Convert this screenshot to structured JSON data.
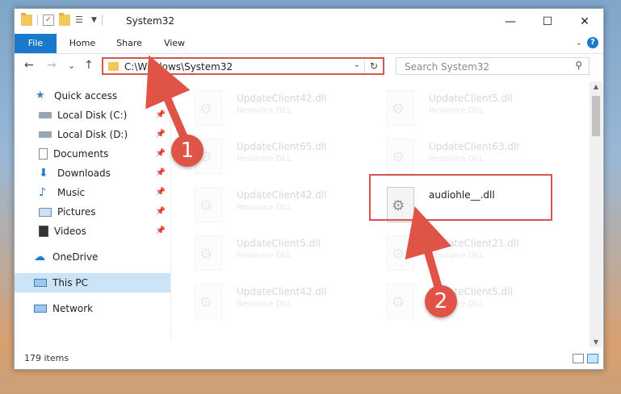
{
  "window": {
    "title": "System32",
    "controls": {
      "minimize": "—",
      "maximize": "☐",
      "close": "✕"
    }
  },
  "ribbon": {
    "tabs": [
      "File",
      "Home",
      "Share",
      "View"
    ],
    "help": "?"
  },
  "navigation": {
    "back": "←",
    "forward": "→",
    "recent": "⌄",
    "up": "↑",
    "address": "C:\\Windows\\System32",
    "search_placeholder": "Search System32"
  },
  "sidebar": {
    "items": [
      {
        "label": "Quick access",
        "icon": "star-icon",
        "pinned": false
      },
      {
        "label": "Local Disk (C:)",
        "icon": "drive-icon",
        "pinned": true
      },
      {
        "label": "Local Disk (D:)",
        "icon": "drive-icon",
        "pinned": true
      },
      {
        "label": "Documents",
        "icon": "documents-icon",
        "pinned": true
      },
      {
        "label": "Downloads",
        "icon": "downloads-icon",
        "pinned": true
      },
      {
        "label": "Music",
        "icon": "music-icon",
        "pinned": true
      },
      {
        "label": "Pictures",
        "icon": "pictures-icon",
        "pinned": true
      },
      {
        "label": "Videos",
        "icon": "videos-icon",
        "pinned": true
      },
      {
        "label": "OneDrive",
        "icon": "cloud-icon",
        "pinned": false
      },
      {
        "label": "This PC",
        "icon": "computer-icon",
        "pinned": false,
        "selected": true
      },
      {
        "label": "Network",
        "icon": "network-icon",
        "pinned": false
      }
    ]
  },
  "files": [
    {
      "name": "UpdateClient42.dll",
      "type": "Resource DLL",
      "faded": true
    },
    {
      "name": "UpdateClient5.dll",
      "type": "Resource DLL",
      "faded": true
    },
    {
      "name": "UpdateClient65.dll",
      "type": "Resource DLL",
      "faded": true
    },
    {
      "name": "UpdateClient63.dll",
      "type": "Resource DLL",
      "faded": true
    },
    {
      "name": "UpdateClient42.dll",
      "type": "Resource DLL",
      "faded": true
    },
    {
      "name": "audiohle__.dll",
      "type": "",
      "faded": false,
      "highlighted": true
    },
    {
      "name": "UpdateClient5.dll",
      "type": "Resource DLL",
      "faded": true
    },
    {
      "name": "UpdateClient21.dll",
      "type": "Resource DLL",
      "faded": true
    },
    {
      "name": "UpdateClient42.dll",
      "type": "Resource DLL",
      "faded": true
    },
    {
      "name": "UpdateClient5.dll",
      "type": "Resource DLL",
      "faded": true
    }
  ],
  "status": {
    "item_count": "179 items"
  },
  "annotations": {
    "step1": "1",
    "step2": "2",
    "color": "#e05347"
  },
  "colors": {
    "accent": "#1979ca",
    "selection": "#cce4f7",
    "highlight": "#d9534f"
  }
}
